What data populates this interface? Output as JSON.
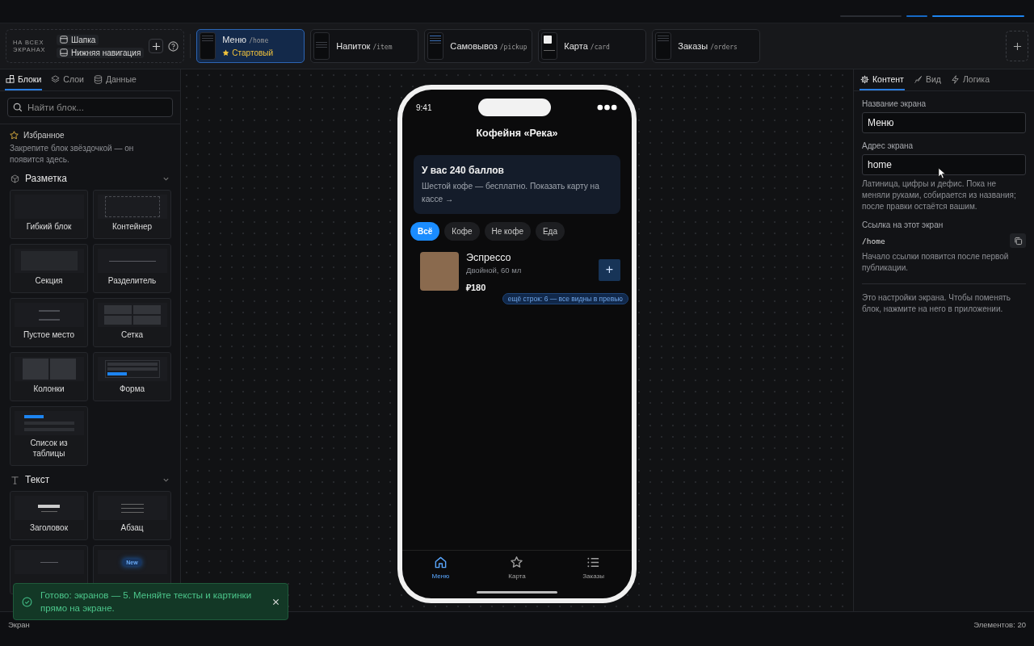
{
  "global": {
    "label": "НА ВСЕХ ЭКРАНАХ",
    "parts": [
      {
        "label": "Шапка",
        "kind": "header"
      },
      {
        "label": "Нижняя навигация",
        "kind": "footer"
      }
    ]
  },
  "screens": [
    {
      "name": "Меню",
      "path": "/home",
      "selected": true,
      "badge": "Стартовый",
      "kind": "list"
    },
    {
      "name": "Напиток",
      "path": "/item",
      "selected": false,
      "kind": "detail"
    },
    {
      "name": "Самовывоз",
      "path": "/pickup",
      "selected": false,
      "kind": "form"
    },
    {
      "name": "Карта",
      "path": "/card",
      "selected": false,
      "kind": "qr"
    },
    {
      "name": "Заказы",
      "path": "/orders",
      "selected": false,
      "kind": "list"
    }
  ],
  "left_tabs": [
    {
      "label": "Блоки",
      "selected": true,
      "kind": "blocks"
    },
    {
      "label": "Слои",
      "selected": false,
      "kind": "layers"
    },
    {
      "label": "Данные",
      "selected": false,
      "kind": "data"
    }
  ],
  "search": {
    "placeholder": "Найти блок..."
  },
  "favorites": {
    "title": "Избранное",
    "hint": "Закрепите блок звёздочкой — он появится здесь."
  },
  "groups": [
    {
      "title": "Разметка",
      "kind": "layout",
      "expanded": true,
      "blocks": [
        {
          "label": "Гибкий блок",
          "kind": "flex"
        },
        {
          "label": "Контейнер",
          "kind": "container"
        },
        {
          "label": "Секция",
          "kind": "section"
        },
        {
          "label": "Разделитель",
          "kind": "divider"
        },
        {
          "label": "Пустое место",
          "kind": "spacer"
        },
        {
          "label": "Сетка",
          "kind": "grid"
        },
        {
          "label": "Колонки",
          "kind": "columns"
        },
        {
          "label": "Форма",
          "kind": "form"
        },
        {
          "label": "Список из таблицы",
          "kind": "repeater"
        }
      ]
    },
    {
      "title": "Текст",
      "kind": "text",
      "expanded": true,
      "blocks": [
        {
          "label": "Заголовок",
          "kind": "heading"
        },
        {
          "label": "Абзац",
          "kind": "paragraph"
        },
        {
          "kind": "caption"
        },
        {
          "kind": "badge",
          "badge": "New"
        }
      ]
    }
  ],
  "phone": {
    "time": "9:41",
    "title": "Кофейня «Река»",
    "promo": {
      "title": "У вас 240 баллов",
      "text": "Шестой кофе — бесплатно. Показать карту на кассе →"
    },
    "chips": [
      {
        "label": "Всё",
        "selected": true
      },
      {
        "label": "Кофе",
        "selected": false
      },
      {
        "label": "Не кофе",
        "selected": false
      },
      {
        "label": "Еда",
        "selected": false
      }
    ],
    "product": {
      "name": "Эспрессо",
      "desc": "Двойной, 60 мл",
      "price": "₽180",
      "add": "+"
    },
    "more_rows": "ещё строк: 6 — все видны в превью",
    "tabbar": [
      {
        "label": "Меню",
        "kind": "home",
        "selected": true
      },
      {
        "label": "Карта",
        "kind": "star",
        "selected": false
      },
      {
        "label": "Заказы",
        "kind": "list",
        "selected": false
      }
    ]
  },
  "right_tabs": [
    {
      "label": "Контент",
      "kind": "gear",
      "selected": true
    },
    {
      "label": "Вид",
      "kind": "brush",
      "selected": false
    },
    {
      "label": "Логика",
      "kind": "bolt",
      "selected": false
    }
  ],
  "settings": {
    "name_label": "Название экрана",
    "name_value": "Меню",
    "address_label": "Адрес экрана",
    "address_value": "home",
    "address_hint": "Латиница, цифры и дефис. Пока не меняли руками, собирается из названия; после правки остаётся вашим.",
    "link_label": "Ссылка на этот экран",
    "link_value": "/home",
    "link_hint": "Начало ссылки появится после первой публикации.",
    "note": "Это настройки экрана. Чтобы поменять блок, нажмите на него в приложении."
  },
  "toast": {
    "text": "Готово: экранов — 5. Меняйте тексты и картинки прямо на экране."
  },
  "status_bar": {
    "left": "Экран",
    "right": "Элементов: 20"
  }
}
